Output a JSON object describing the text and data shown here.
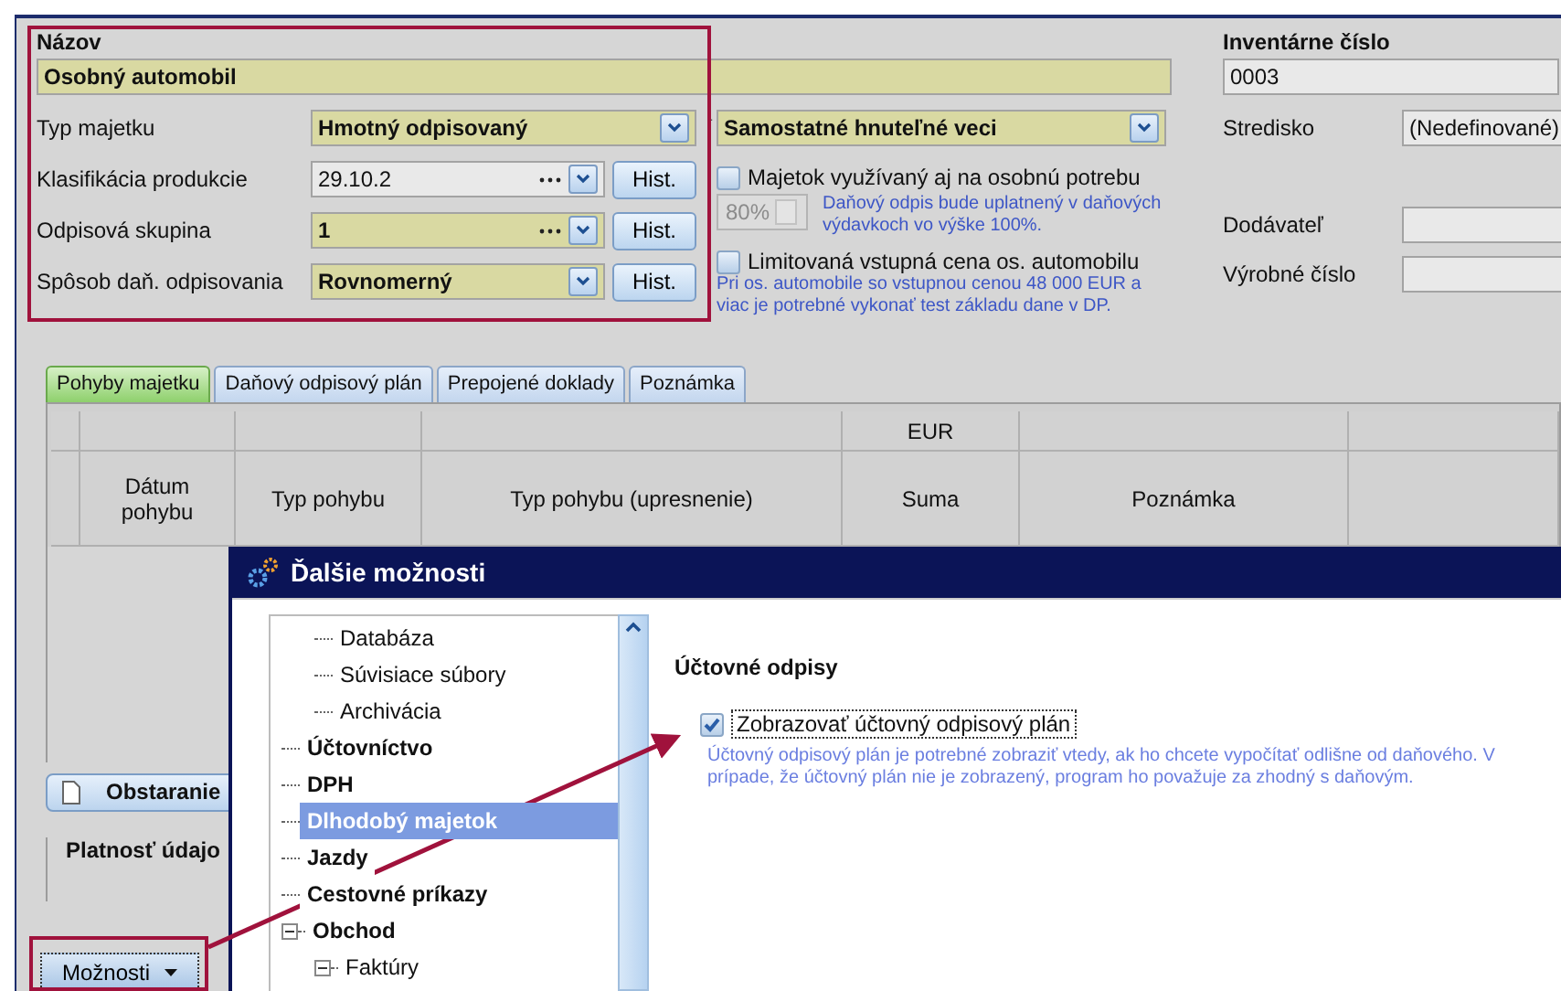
{
  "form": {
    "name_label": "Názov",
    "name_value": "Osobný automobil",
    "rows": [
      {
        "label": "Typ majetku",
        "kind": "combo",
        "value": "Hmotný odpisovaný",
        "highlighted": true
      },
      {
        "label": "Klasifikácia produkcie",
        "kind": "lookup",
        "value": "29.10.2",
        "highlighted": false,
        "button": "Hist."
      },
      {
        "label": "Odpisová skupina",
        "kind": "lookup",
        "value": "1",
        "highlighted": true,
        "button": "Hist."
      },
      {
        "label": "Spôsob daň. odpisovania",
        "kind": "select",
        "value": "Rovnomerný",
        "highlighted": true,
        "button": "Hist."
      }
    ],
    "type_separator": "-",
    "category": "Samostatné hnuteľné veci",
    "personal_use": {
      "label": "Majetok využívaný aj na osobnú potrebu",
      "checked": false
    },
    "share": {
      "value": "80%",
      "disabled": true
    },
    "share_note": "Daňový odpis bude uplatnený v daňových výdavkoch vo výške 100%.",
    "limited_price": {
      "label": "Limitovaná vstupná cena os. automobilu",
      "checked": false
    },
    "limited_note": "Pri os. automobile so vstupnou cenou  48 000 EUR a viac je potrebné vykonať test základu dane v DP.",
    "inventory_label": "Inventárne číslo",
    "inventory_value": "0003",
    "side_fields": [
      {
        "label": "Stredisko",
        "value": "(Nedefinované)"
      },
      {
        "label": "Dodávateľ"
      },
      {
        "label": "Výrobné číslo"
      }
    ]
  },
  "tabs": [
    {
      "label": "Pohyby majetku",
      "selected": true
    },
    {
      "label": "Daňový odpisový plán",
      "selected": false
    },
    {
      "label": "Prepojené doklady",
      "selected": false
    },
    {
      "label": "Poznámka",
      "selected": false
    }
  ],
  "table": {
    "columns": [
      {
        "label": "Dátum pohybu"
      },
      {
        "label": "Typ pohybu"
      },
      {
        "label": "Typ pohybu (upresnenie)"
      },
      {
        "label": "Suma",
        "group": "EUR"
      },
      {
        "label": "Poznámka"
      }
    ]
  },
  "obstaranie_button": "Obstaranie",
  "validity_label": "Platnosť údajo",
  "options_button": "Možnosti",
  "dialog": {
    "title": "Ďalšie možnosti",
    "tree": [
      {
        "children": [
          {
            "label": "Databáza",
            "selected": false
          },
          {
            "label": "Súvisiace súbory",
            "selected": false
          },
          {
            "label": "Archivácia",
            "selected": false
          }
        ]
      },
      {
        "label": "Účtovníctvo",
        "selected": false
      },
      {
        "label": "DPH",
        "selected": false
      },
      {
        "label": "Dlhodobý majetok",
        "selected": true
      },
      {
        "label": "Jazdy",
        "selected": false
      },
      {
        "label": "Cestovné príkazy",
        "selected": false
      },
      {
        "label": "Obchod",
        "selected": false,
        "expanded": true,
        "children": [
          {
            "label": "Faktúry",
            "selected": false,
            "expanded": true
          }
        ]
      }
    ],
    "section_title": "Účtovné odpisy",
    "option": {
      "label": "Zobrazovať účtovný odpisový plán",
      "checked": true
    },
    "option_note": "Účtovný odpisový plán je potrebné zobraziť vtedy, ak ho chcete vypočítať odlišne od daňového. V prípade, že účtovný plán nie je zobrazený, program ho považuje za zhodný s daňovým."
  }
}
